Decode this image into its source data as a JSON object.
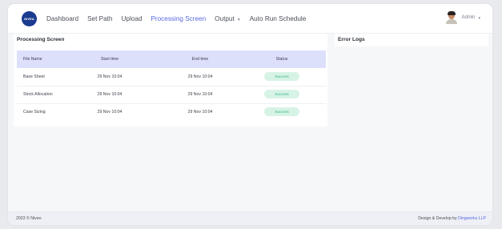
{
  "header": {
    "logo_text": "NIVEA",
    "nav": [
      {
        "label": "Dashboard"
      },
      {
        "label": "Set Path"
      },
      {
        "label": "Upload"
      },
      {
        "label": "Processing Screen",
        "active": true
      },
      {
        "label": "Output",
        "dropdown": true
      },
      {
        "label": "Auto Run Schedule"
      }
    ],
    "user": {
      "name": "Admin"
    }
  },
  "processing": {
    "title": "Processing Screen",
    "columns": [
      "File Name",
      "Start time",
      "End time",
      "Status"
    ],
    "rows": [
      {
        "file": "Base Sheet",
        "start": "29 Nov 10:04",
        "end": "29 Nov 10:04",
        "status": "Success"
      },
      {
        "file": "Stock Allocation",
        "start": "29 Nov 10:04",
        "end": "29 Nov 10:04",
        "status": "Success"
      },
      {
        "file": "Case Sizing",
        "start": "29 Nov 10:04",
        "end": "29 Nov 10:04",
        "status": "Success"
      }
    ]
  },
  "error_logs": {
    "title": "Error Logs"
  },
  "footer": {
    "left": "2023 © Niveo",
    "right_prefix": "Design & Develop by",
    "right_link": "Dingworks LLP"
  },
  "colors": {
    "accent": "#5668e0",
    "table_header_bg": "#dde0fb",
    "success_bg": "#d7f3e6",
    "success_text": "#33b886",
    "logo_bg": "#1b3b8f"
  }
}
